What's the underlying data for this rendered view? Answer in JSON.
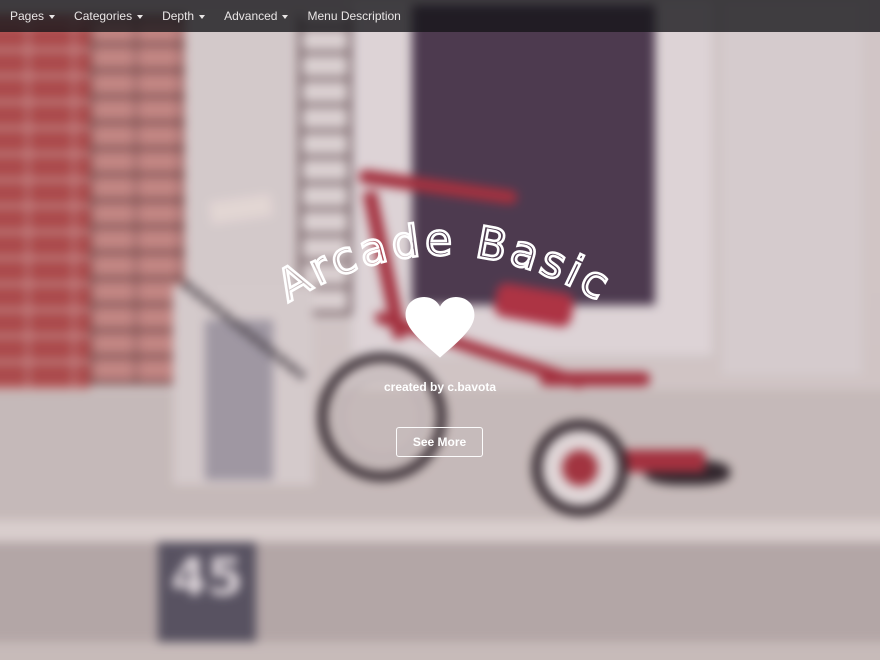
{
  "nav": {
    "items": [
      {
        "label": "Pages",
        "dropdown": true
      },
      {
        "label": "Categories",
        "dropdown": true
      },
      {
        "label": "Depth",
        "dropdown": true
      },
      {
        "label": "Advanced",
        "dropdown": true
      },
      {
        "label": "Menu Description",
        "dropdown": false
      }
    ]
  },
  "hero": {
    "title": "Arcade Basic",
    "icon": "heart-icon",
    "credit": "created by c.bavota",
    "button_label": "See More"
  },
  "background": {
    "sign_number": "45"
  },
  "colors": {
    "nav_bg": "#1a1a1e",
    "accent": "#ffffff",
    "tricycle": "#a8303c"
  }
}
